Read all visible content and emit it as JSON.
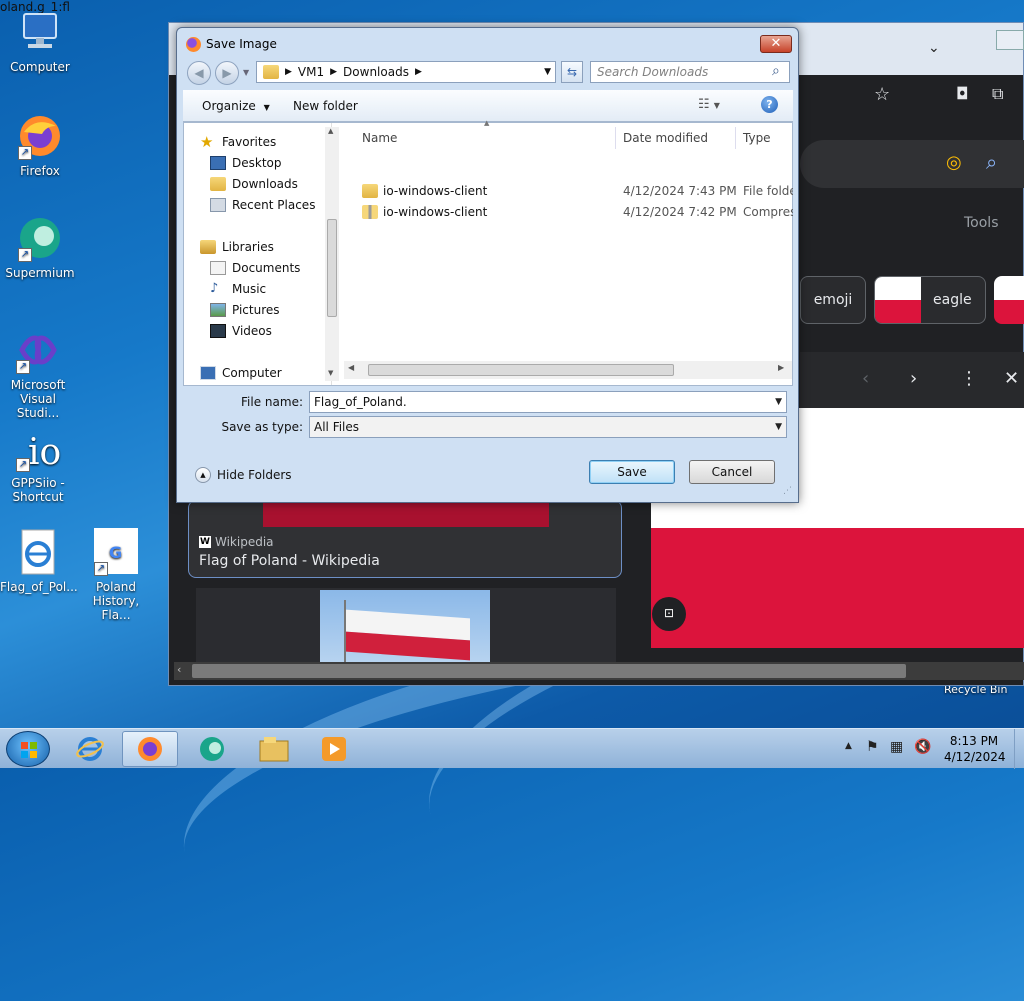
{
  "desktop": {
    "icons": [
      {
        "label": "Computer"
      },
      {
        "label": "Firefox"
      },
      {
        "label": "Supermium"
      },
      {
        "label_line1": "Microsoft",
        "label_line2": "Visual Studi..."
      },
      {
        "label_line1": "GPPSiio -",
        "label_line2": "Shortcut"
      },
      {
        "label": "Flag_of_Pol..."
      },
      {
        "label_line1": "Poland",
        "label_line2": "History, Fla..."
      }
    ],
    "recycle_bin": "Recycle Bin"
  },
  "browser": {
    "address_fragment": "oland.g_1:fl",
    "tools_label": "Tools",
    "chips": [
      {
        "label": "emoji"
      },
      {
        "label": "eagle"
      }
    ],
    "result_source": "Wikipedia",
    "result_title": "Flag of Poland - Wikipedia"
  },
  "dialog": {
    "title": "Save Image",
    "breadcrumb": [
      "VM1",
      "Downloads"
    ],
    "search_placeholder": "Search Downloads",
    "toolbar": {
      "organize": "Organize",
      "new_folder": "New folder"
    },
    "nav": {
      "favorites": "Favorites",
      "desktop": "Desktop",
      "downloads": "Downloads",
      "recent_places": "Recent Places",
      "libraries": "Libraries",
      "documents": "Documents",
      "music": "Music",
      "pictures": "Pictures",
      "videos": "Videos",
      "computer": "Computer"
    },
    "columns": {
      "name": "Name",
      "date_modified": "Date modified",
      "type": "Type"
    },
    "files": [
      {
        "name": "io-windows-client",
        "date": "4/12/2024 7:43 PM",
        "type": "File folder"
      },
      {
        "name": "io-windows-client",
        "date": "4/12/2024 7:42 PM",
        "type": "Compress"
      }
    ],
    "file_name_label": "File name:",
    "file_name_value": "Flag_of_Poland.",
    "save_as_type_label": "Save as type:",
    "save_as_type_value": "All Files",
    "hide_folders": "Hide Folders",
    "save_button": "Save",
    "cancel_button": "Cancel"
  },
  "taskbar": {
    "time": "8:13 PM",
    "date": "4/12/2024"
  }
}
